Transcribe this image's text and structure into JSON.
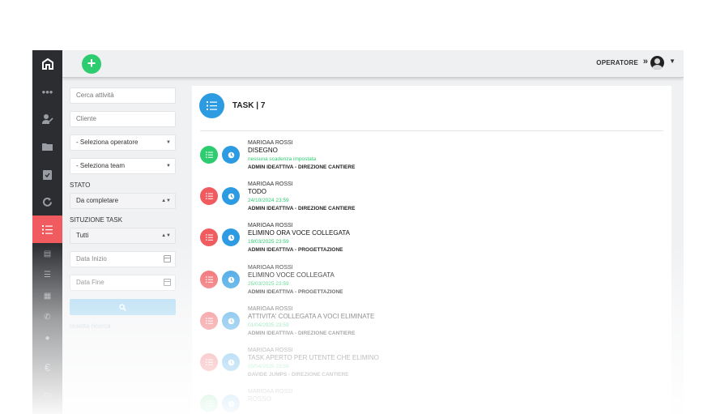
{
  "topbar": {
    "operatore_label": "OPERATORE",
    "operatore_arrow": "»"
  },
  "filters": {
    "search_placeholder": "Cerca attività",
    "cliente_placeholder": "Cliente",
    "operatore_select": "- Seleziona operatore",
    "team_select": "- Seleziona team",
    "stato_label": "STATO",
    "stato_value": "Da completare",
    "situazione_label": "SITUZIONE TASK",
    "situazione_value": "Tutti",
    "data_inizio_placeholder": "Data Inizio",
    "data_fine_placeholder": "Data Fine",
    "reset_label": "resetta ricerca"
  },
  "panel": {
    "title": "TASK | 7"
  },
  "colors": {
    "accent_blue": "#2d9be2",
    "red": "#ef5b5f",
    "green": "#2ecc71",
    "sidebar": "#2b2d31"
  },
  "tasks": [
    {
      "user": "MARIOAA ROSSI",
      "name": "DISEGNO",
      "date": "nessuna scadenza impostata",
      "admin": "ADMIN IDEATTIVA - DIREZIONE CANTIERE",
      "status_color": "#2ecc71"
    },
    {
      "user": "MARIOAA ROSSI",
      "name": "TODO",
      "date": "24/10/2024 23:59",
      "admin": "ADMIN IDEATTIVA - DIREZIONE CANTIERE",
      "status_color": "#ef5b5f"
    },
    {
      "user": "MARIOAA ROSSI",
      "name": "ELIMINO ORA VOCE COLLEGATA",
      "date": "19/03/2025 23:59",
      "admin": "ADMIN IDEATTIVA - PROGETTAZIONE",
      "status_color": "#ef5b5f"
    },
    {
      "user": "MARIOAA ROSSI",
      "name": "ELIMINO VOCE COLLEGATA",
      "date": "25/03/2025 23:59",
      "admin": "ADMIN IDEATTIVA - PROGETTAZIONE",
      "status_color": "#ef5b5f"
    },
    {
      "user": "MARIOAA ROSSI",
      "name": "ATTIVITA' COLLEGATA A VOCI ELIMINATE",
      "date": "01/04/2025 23:59",
      "admin": "ADMIN IDEATTIVA - DIREZIONE CANTIERE",
      "status_color": "#ef5b5f"
    },
    {
      "user": "MARIOAA ROSSI",
      "name": "TASK APERTO PER UTENTE CHE ELIMINO",
      "date": "05/04/2025 23:59",
      "admin": "DAVIDE JUMPS - DIREZIONE CANTIERE",
      "status_color": "#ef5b5f"
    },
    {
      "user": "MARIOAA ROSSI",
      "name": "ROSSO",
      "date": "",
      "admin": "",
      "status_color": "#2ecc71"
    }
  ]
}
